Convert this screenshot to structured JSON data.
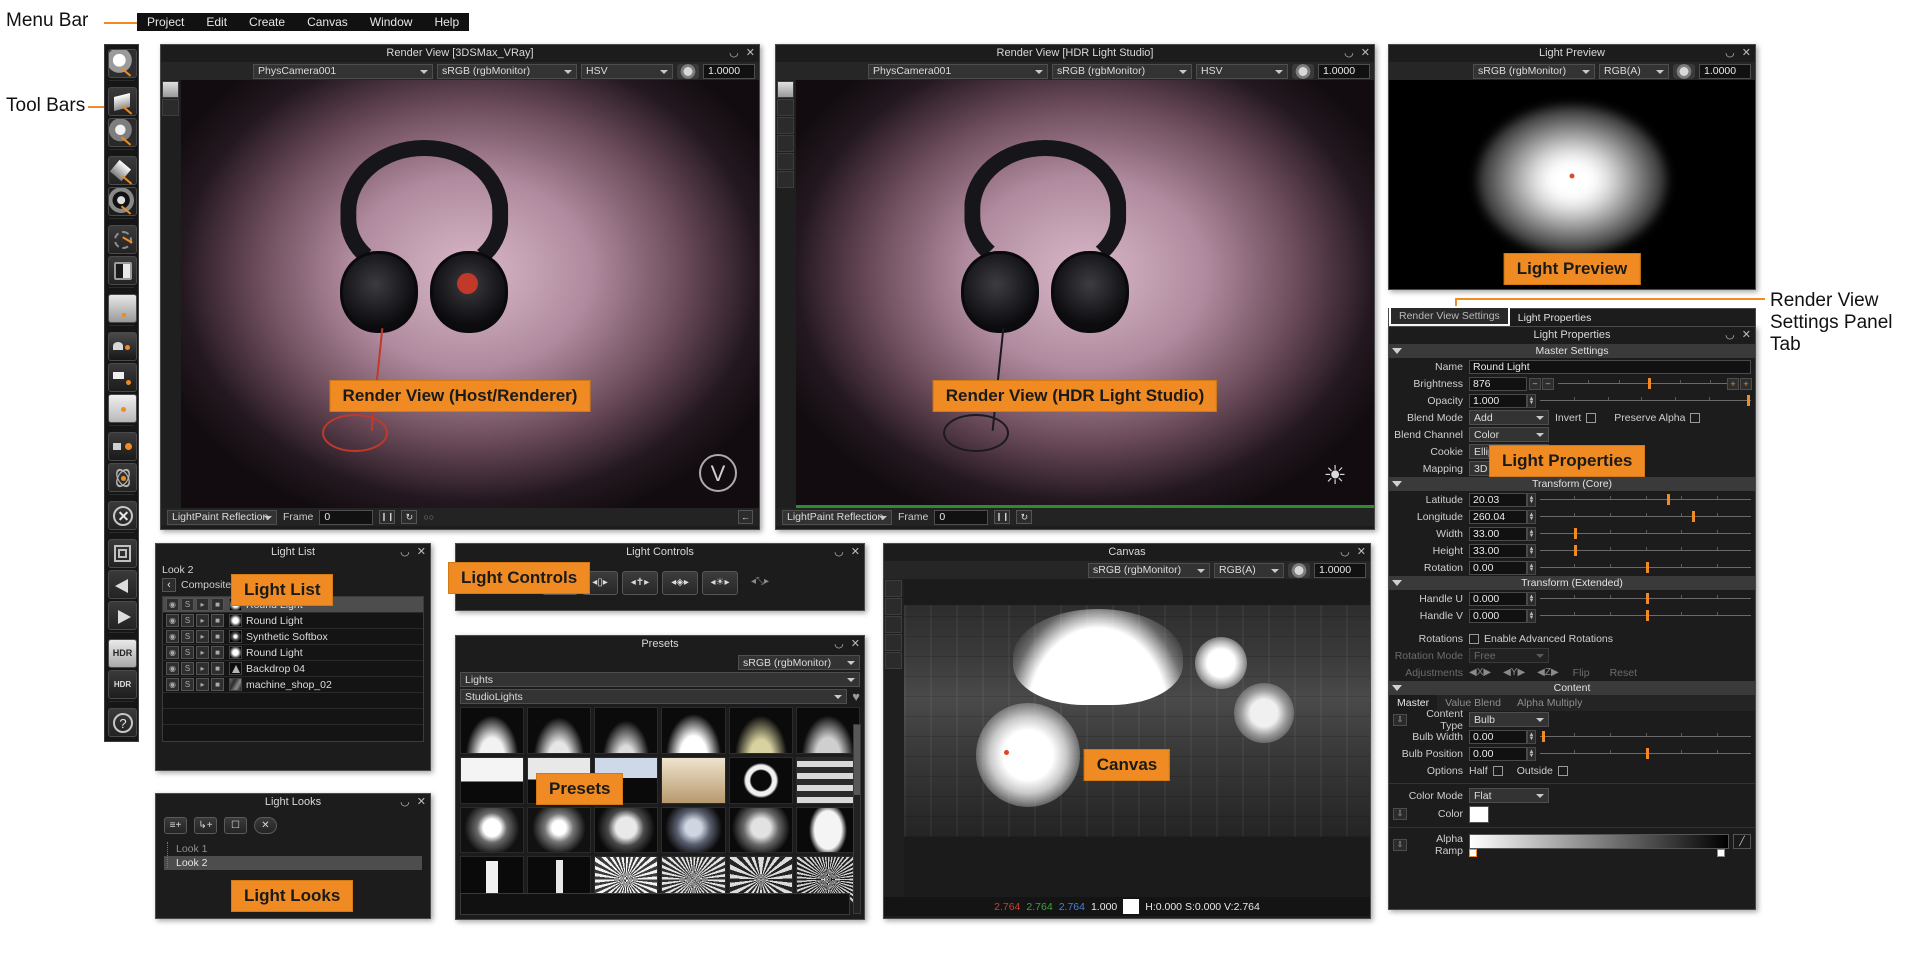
{
  "annotations": {
    "menu_bar": "Menu Bar",
    "tool_bars": "Tool Bars",
    "render_view_settings_panel_tab": "Render View\nSettings Panel Tab"
  },
  "menubar": {
    "items": [
      "Project",
      "Edit",
      "Create",
      "Canvas",
      "Window",
      "Help"
    ]
  },
  "toolbar": {
    "icons": [
      "light-paint-icon",
      "plane-light-icon",
      "spot-light-icon",
      "diamond-light-icon",
      "multi-light-icon",
      "rotate-dial-icon",
      "brightness-icon",
      "gradient-bar-icon",
      "backdrop-icon",
      "bar-light-icon",
      "white-bar-icon",
      "scene-light-icon",
      "atom-icon",
      "delete-x-icon",
      "duplicate-icon",
      "arrow-left-icon",
      "arrow-right-icon",
      "hdr-icon",
      "hdr-refresh-icon",
      "help-icon"
    ]
  },
  "render_view_host": {
    "title": "Render View [3DSMax_VRay]",
    "camera": "PhysCamera001",
    "colorspace": "sRGB (rgbMonitor)",
    "channel": "HSV",
    "exposure": "1.0000",
    "overlay": "Render View (Host/Renderer)",
    "mode": "LightPaint Reflection",
    "frame_label": "Frame",
    "frame_value": "0",
    "buttons": [
      "pause-button",
      "refresh-button"
    ]
  },
  "render_view_hdr": {
    "title": "Render View [HDR Light Studio]",
    "camera": "PhysCamera001",
    "colorspace": "sRGB (rgbMonitor)",
    "channel": "HSV",
    "exposure": "1.0000",
    "overlay": "Render View (HDR Light Studio)",
    "mode": "LightPaint Reflection",
    "frame_label": "Frame",
    "frame_value": "0"
  },
  "light_preview": {
    "title": "Light Preview",
    "colorspace": "sRGB (rgbMonitor)",
    "channel": "RGB(A)",
    "exposure": "1.0000",
    "overlay": "Light Preview"
  },
  "panel_tabs": {
    "tabs": [
      "Render View Settings",
      "Light Properties"
    ],
    "active": "Render View Settings"
  },
  "light_properties": {
    "title": "Light Properties",
    "overlay": "Light Properties",
    "sections": {
      "master": "Master Settings",
      "transform_core": "Transform (Core)",
      "transform_ext": "Transform (Extended)",
      "content": "Content"
    },
    "master": [
      {
        "label": "Name",
        "value": "Round Light",
        "type": "text"
      },
      {
        "label": "Brightness",
        "value": "876",
        "type": "slider",
        "pos": 53
      },
      {
        "label": "Opacity",
        "value": "1.000",
        "type": "slider",
        "pos": 98
      },
      {
        "label": "Blend Mode",
        "value": "Add",
        "type": "dropdown"
      },
      {
        "label": "Blend Channel",
        "value": "Color",
        "type": "dropdown"
      },
      {
        "label": "Cookie",
        "value": "Ellipse",
        "type": "dropdown"
      },
      {
        "label": "Mapping",
        "value": "3D",
        "type": "dropdown"
      }
    ],
    "master_checks": [
      {
        "label": "Invert",
        "checked": false
      },
      {
        "label": "Preserve Alpha",
        "checked": false
      }
    ],
    "transform_core": [
      {
        "label": "Latitude",
        "value": "20.03",
        "pos": 60
      },
      {
        "label": "Longitude",
        "value": "260.04",
        "pos": 72
      },
      {
        "label": "Width",
        "value": "33.00",
        "pos": 16
      },
      {
        "label": "Height",
        "value": "33.00",
        "pos": 16
      },
      {
        "label": "Rotation",
        "value": "0.00",
        "pos": 50
      }
    ],
    "transform_ext": [
      {
        "label": "Handle U",
        "value": "0.000",
        "pos": 50
      },
      {
        "label": "Handle V",
        "value": "0.000",
        "pos": 50
      }
    ],
    "rotations": {
      "label": "Rotations",
      "checkbox_label": "Enable Advanced Rotations",
      "checked": false,
      "mode_label": "Rotation Mode",
      "mode_value": "Free",
      "adjust_label": "Adjustments",
      "axes": [
        "X",
        "Y",
        "Z"
      ],
      "flip": "Flip",
      "reset": "Reset"
    },
    "content": {
      "tabs": [
        "Master",
        "Value Blend",
        "Alpha Multiply"
      ],
      "active": "Master",
      "rows": [
        {
          "label": "Content Type",
          "value": "Bulb",
          "type": "dropdown"
        },
        {
          "label": "Bulb Width",
          "value": "0.00",
          "type": "slider",
          "pos": 1
        },
        {
          "label": "Bulb Position",
          "value": "0.00",
          "type": "slider",
          "pos": 50
        }
      ],
      "options_label": "Options",
      "options": [
        {
          "label": "Half",
          "checked": false
        },
        {
          "label": "Outside",
          "checked": false
        }
      ],
      "color_mode_label": "Color Mode",
      "color_mode_value": "Flat",
      "color_label": "Color",
      "color_value": "#ffffff",
      "alpha_ramp_label": "Alpha Ramp"
    }
  },
  "light_list": {
    "title": "Light List",
    "overlay": "Light List",
    "look": "Look 2",
    "breadcrumb": "Composite Lighting",
    "rows": [
      {
        "name": "Round Light",
        "thumb": "round-light-thumb",
        "selected": true
      },
      {
        "name": "Round Light",
        "thumb": "round-light-thumb",
        "selected": false
      },
      {
        "name": "Synthetic Softbox",
        "thumb": "softbox-thumb",
        "selected": false
      },
      {
        "name": "Round Light",
        "thumb": "round-light-thumb",
        "selected": false
      },
      {
        "name": "Backdrop 04",
        "thumb": "backdrop-thumb",
        "selected": false
      },
      {
        "name": "machine_shop_02",
        "thumb": "hdri-thumb",
        "selected": false
      }
    ],
    "row_toggles": [
      "visibility-toggle",
      "solo-toggle",
      "select-toggle",
      "lock-toggle"
    ]
  },
  "light_looks": {
    "title": "Light Looks",
    "overlay": "Light Looks",
    "toolbar_icons": [
      "add-look-icon",
      "add-child-look-icon",
      "duplicate-look-icon",
      "delete-look-icon"
    ],
    "items": [
      {
        "label": "Look 1",
        "selected": false
      },
      {
        "label": "Look 2",
        "selected": true
      }
    ]
  },
  "light_controls": {
    "title": "Light Controls",
    "overlay": "Light Controls",
    "tools": [
      "scale-tool",
      "width-tool",
      "height-tool",
      "rotate-tool",
      "brightness-tool",
      "fit-tool"
    ]
  },
  "presets": {
    "title": "Presets",
    "overlay": "Presets",
    "colorspace": "sRGB (rgbMonitor)",
    "category": "Lights",
    "subcategory": "StudioLights",
    "favorite_icon": "heart-icon",
    "rows": 4,
    "cols": 6
  },
  "canvas": {
    "title": "Canvas",
    "overlay": "Canvas",
    "colorspace": "sRGB (rgbMonitor)",
    "channel": "RGB(A)",
    "exposure": "1.0000",
    "readout": {
      "r": "2.764",
      "g": "2.764",
      "b": "2.764",
      "a": "1.000",
      "hsv": "H:0.000 S:0.000 V:2.764"
    },
    "tool_icons": [
      "move-icon",
      "select-icon",
      "zoom-icon",
      "pan-icon",
      "fit-icon"
    ]
  },
  "colors": {
    "accent": "#ef8b22",
    "panel_bg": "#1c1c1c",
    "panel_border": "#4a4a4a",
    "text": "#d8d8d8"
  }
}
